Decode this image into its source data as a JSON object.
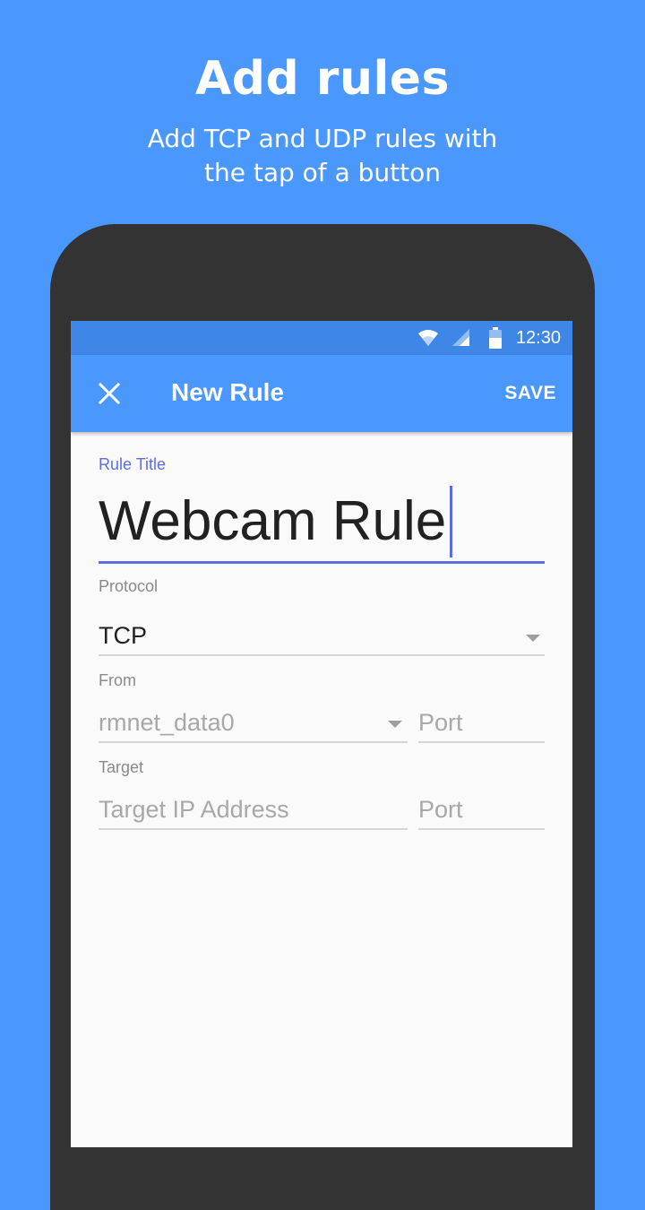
{
  "promo": {
    "title": "Add rules",
    "subtitle_line1": "Add TCP and UDP rules with",
    "subtitle_line2": "the tap of a button"
  },
  "status_bar": {
    "time": "12:30",
    "icons": [
      "wifi-icon",
      "cell-signal-icon",
      "battery-icon"
    ]
  },
  "app_bar": {
    "close_icon": "close-icon",
    "title": "New Rule",
    "save_label": "SAVE"
  },
  "form": {
    "rule_title_label": "Rule Title",
    "rule_title_value": "Webcam Rule",
    "protocol_label": "Protocol",
    "protocol_value": "TCP",
    "from_label": "From",
    "from_interface_value": "rmnet_data0",
    "from_port_placeholder": "Port",
    "target_label": "Target",
    "target_ip_placeholder": "Target IP Address",
    "target_port_placeholder": "Port"
  },
  "colors": {
    "background": "#4A97FD",
    "status_bar": "#3F87E6",
    "accent": "#5A6FE0",
    "phone_body": "#333333"
  }
}
